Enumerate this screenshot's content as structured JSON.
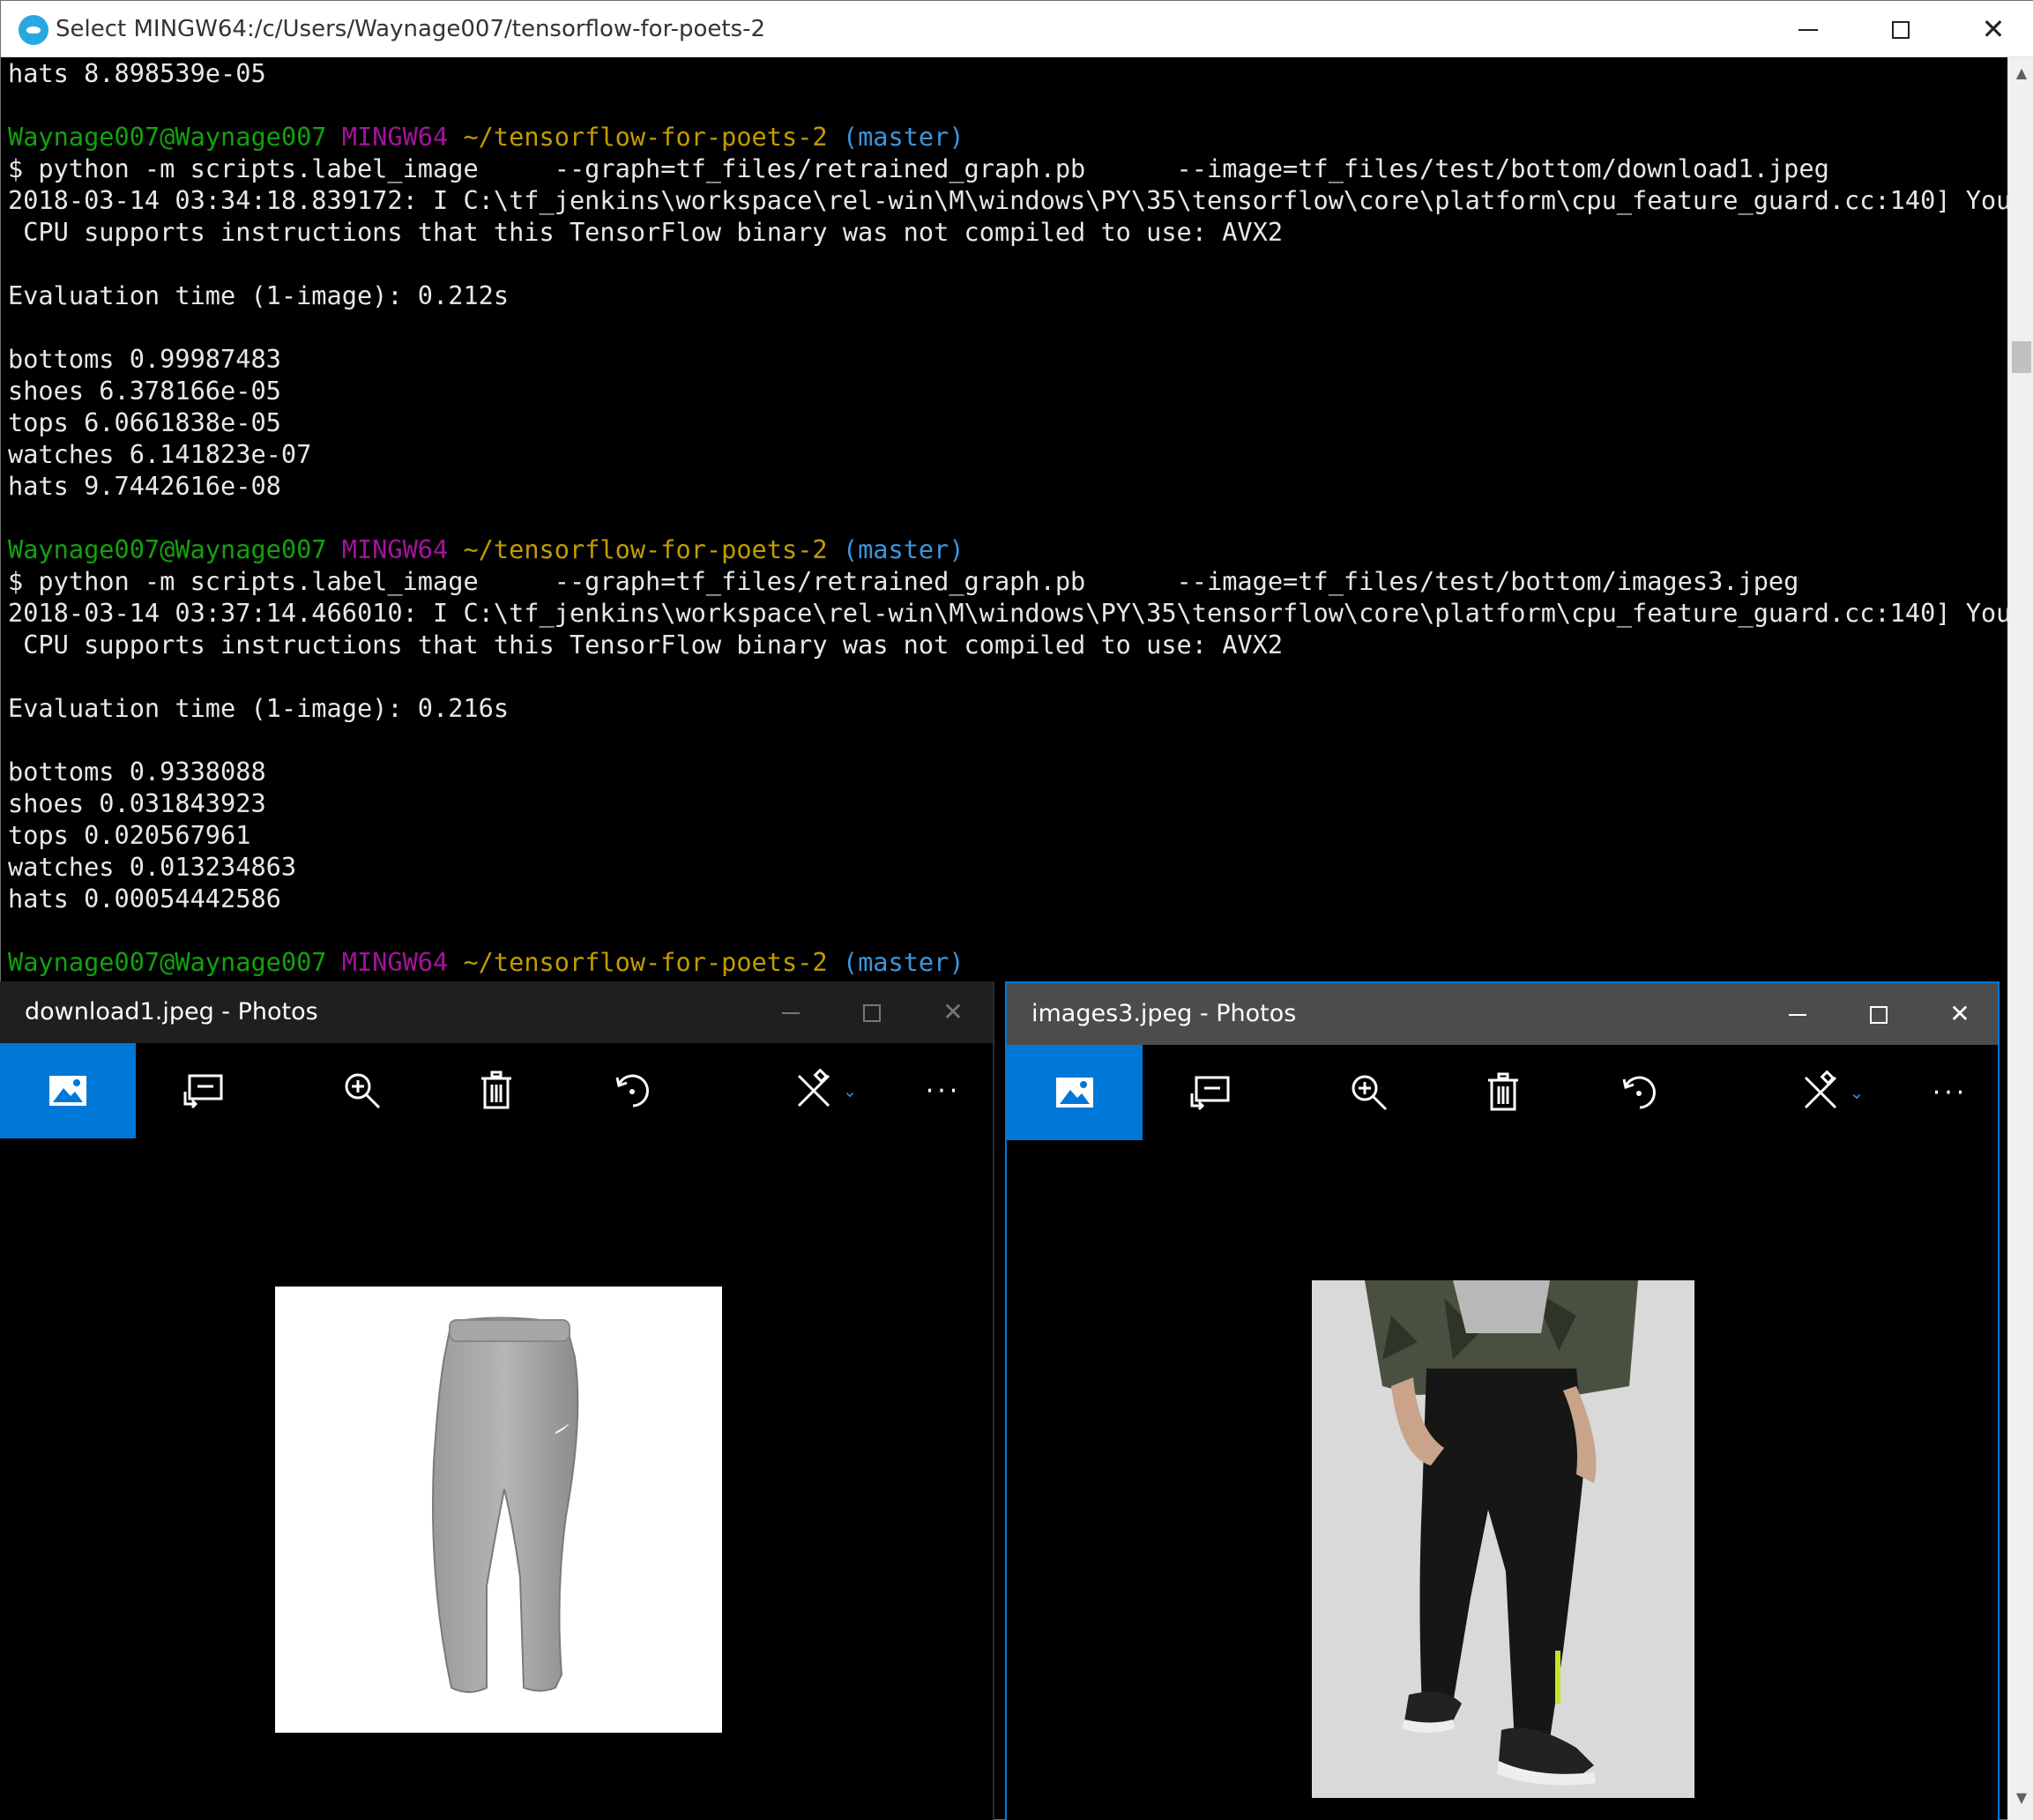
{
  "terminal": {
    "title": "Select MINGW64:/c/Users/Waynage007/tensorflow-for-poets-2",
    "lines": [
      {
        "text": "hats 8.898539e-05"
      },
      {
        "text": ""
      },
      {
        "prompt": {
          "user": "Waynage007@Waynage007",
          "host": "MINGW64",
          "path": "~/tensorflow-for-poets-2",
          "branch": "(master)"
        }
      },
      {
        "text": "$ python -m scripts.label_image     --graph=tf_files/retrained_graph.pb      --image=tf_files/test/bottom/download1.jpeg"
      },
      {
        "text": "2018-03-14 03:34:18.839172: I C:\\tf_jenkins\\workspace\\rel-win\\M\\windows\\PY\\35\\tensorflow\\core\\platform\\cpu_feature_guard.cc:140] Your"
      },
      {
        "text": " CPU supports instructions that this TensorFlow binary was not compiled to use: AVX2"
      },
      {
        "text": ""
      },
      {
        "text": "Evaluation time (1-image): 0.212s"
      },
      {
        "text": ""
      },
      {
        "text": "bottoms 0.99987483"
      },
      {
        "text": "shoes 6.378166e-05"
      },
      {
        "text": "tops 6.0661838e-05"
      },
      {
        "text": "watches 6.141823e-07"
      },
      {
        "text": "hats 9.7442616e-08"
      },
      {
        "text": ""
      },
      {
        "prompt": {
          "user": "Waynage007@Waynage007",
          "host": "MINGW64",
          "path": "~/tensorflow-for-poets-2",
          "branch": "(master)"
        }
      },
      {
        "text": "$ python -m scripts.label_image     --graph=tf_files/retrained_graph.pb      --image=tf_files/test/bottom/images3.jpeg"
      },
      {
        "text": "2018-03-14 03:37:14.466010: I C:\\tf_jenkins\\workspace\\rel-win\\M\\windows\\PY\\35\\tensorflow\\core\\platform\\cpu_feature_guard.cc:140] Your"
      },
      {
        "text": " CPU supports instructions that this TensorFlow binary was not compiled to use: AVX2"
      },
      {
        "text": ""
      },
      {
        "text": "Evaluation time (1-image): 0.216s"
      },
      {
        "text": ""
      },
      {
        "text": "bottoms 0.9338088"
      },
      {
        "text": "shoes 0.031843923"
      },
      {
        "text": "tops 0.020567961"
      },
      {
        "text": "watches 0.013234863"
      },
      {
        "text": "hats 0.00054442586"
      },
      {
        "text": ""
      },
      {
        "prompt": {
          "user": "Waynage007@Waynage007",
          "host": "MINGW64",
          "path": "~/tensorflow-for-poets-2",
          "branch": "(master)"
        }
      }
    ],
    "colors": {
      "user": "#13a10e",
      "host": "#a5129d",
      "path": "#c19c00",
      "branch": "#3a96dd"
    }
  },
  "photos_left": {
    "title": "download1.jpeg - Photos",
    "toolbar": [
      "view-icon",
      "slideshow-icon",
      "zoom-in-icon",
      "delete-icon",
      "rotate-icon",
      "edit-create-icon",
      "more-icon"
    ],
    "more_label": "···"
  },
  "photos_right": {
    "title": "images3.jpeg - Photos",
    "toolbar": [
      "view-icon",
      "slideshow-icon",
      "zoom-in-icon",
      "delete-icon",
      "rotate-icon",
      "edit-create-icon",
      "more-icon"
    ],
    "more_label": "···"
  },
  "accent_color": "#0078d7"
}
